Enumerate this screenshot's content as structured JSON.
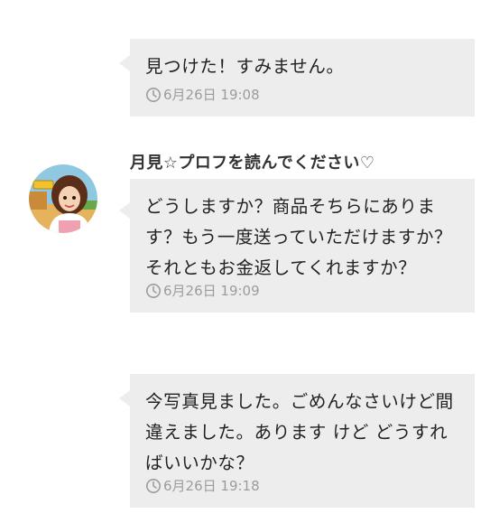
{
  "messages": [
    {
      "text": "見つけた！すみません。",
      "time": "6月26日 19:08"
    },
    {
      "sender": "月見☆プロフを読んでください♡",
      "text": "どうしますか？商品そちらにあります？もう一度送っていただけますか？それともお金返してくれますか？",
      "time": "6月26日 19:09"
    },
    {
      "text": "今写真見ました。ごめんなさいけど間違えました。あります けど どうすればいいかな？",
      "time": "6月26日 19:18"
    }
  ],
  "colors": {
    "bubble": "#ededed",
    "text": "#222222",
    "timestamp": "#9c9c9c"
  },
  "icons": {
    "timestamp": "clock-icon",
    "avatar": "user-avatar-photo"
  }
}
